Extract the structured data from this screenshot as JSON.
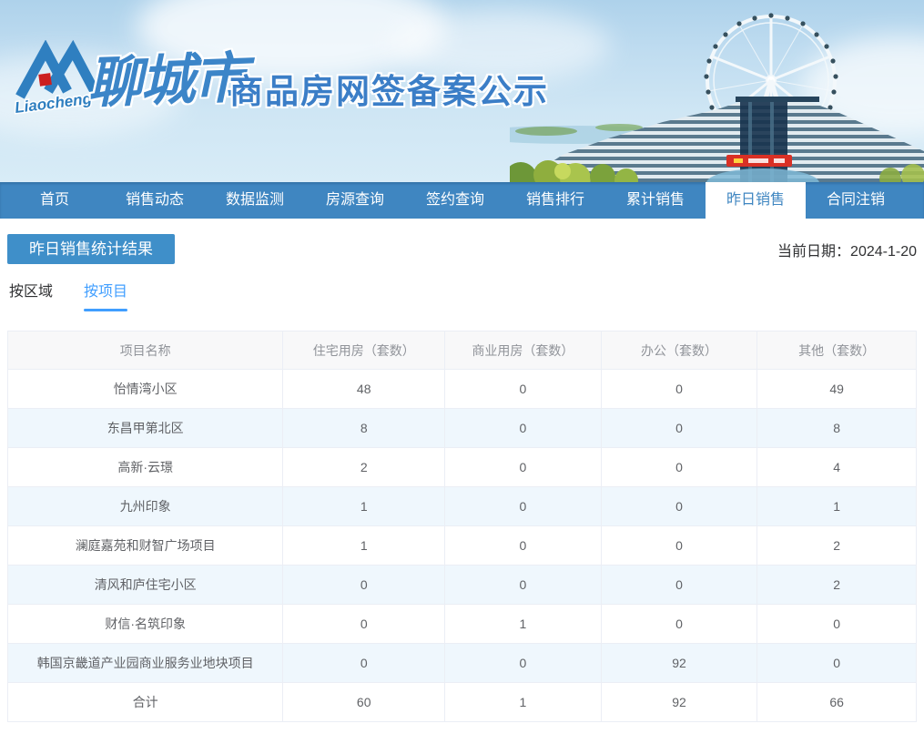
{
  "banner": {
    "logo_script": "Liaocheng",
    "city_name": "聊城市",
    "site_title": "商品房网签备案公示"
  },
  "nav": {
    "items": [
      {
        "label": "首页",
        "active": false
      },
      {
        "label": "销售动态",
        "active": false
      },
      {
        "label": "数据监测",
        "active": false
      },
      {
        "label": "房源查询",
        "active": false
      },
      {
        "label": "签约查询",
        "active": false
      },
      {
        "label": "销售排行",
        "active": false
      },
      {
        "label": "累计销售",
        "active": false
      },
      {
        "label": "昨日销售",
        "active": true
      },
      {
        "label": "合同注销",
        "active": false
      }
    ]
  },
  "page": {
    "section_title": "昨日销售统计结果",
    "date_label": "当前日期：",
    "date_value": "2024-1-20",
    "tabs": [
      {
        "label": "按区域",
        "active": false
      },
      {
        "label": "按项目",
        "active": true
      }
    ]
  },
  "table": {
    "headers": [
      "项目名称",
      "住宅用房（套数）",
      "商业用房（套数）",
      "办公（套数）",
      "其他（套数）"
    ],
    "rows": [
      [
        "怡情湾小区",
        "48",
        "0",
        "0",
        "49"
      ],
      [
        "东昌甲第北区",
        "8",
        "0",
        "0",
        "8"
      ],
      [
        "高新·云璟",
        "2",
        "0",
        "0",
        "4"
      ],
      [
        "九州印象",
        "1",
        "0",
        "0",
        "1"
      ],
      [
        "澜庭嘉苑和财智广场项目",
        "1",
        "0",
        "0",
        "2"
      ],
      [
        "清风和庐住宅小区",
        "0",
        "0",
        "0",
        "2"
      ],
      [
        "财信·名筑印象",
        "0",
        "1",
        "0",
        "0"
      ],
      [
        "韩国京畿道产业园商业服务业地块项目",
        "0",
        "0",
        "92",
        "0"
      ],
      [
        "合计",
        "60",
        "1",
        "92",
        "66"
      ]
    ]
  },
  "colors": {
    "nav_blue": "#3f86c1",
    "badge_blue": "#3f8fc9",
    "tab_active_blue": "#409eff",
    "brand_blue": "#2f7fc0",
    "logo_red": "#cc1f1f",
    "table_border": "#ebeef5",
    "table_header_bg": "#f8f8f9",
    "table_stripe_bg": "#eff7fd",
    "table_header_text": "#909399",
    "table_cell_text": "#606266"
  }
}
